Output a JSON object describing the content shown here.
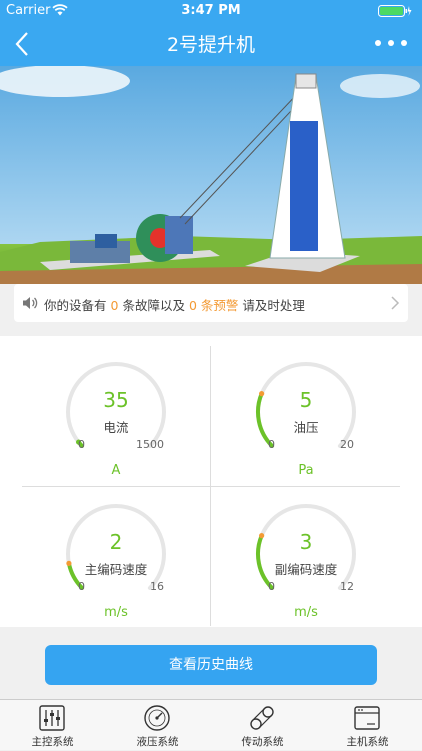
{
  "status_bar": {
    "carrier": "Carrier",
    "time": "3:47 PM"
  },
  "nav": {
    "title": "2号提升机"
  },
  "notice": {
    "prefix": "你的设备有",
    "fault_count": "0",
    "middle": "条故障以及",
    "warning_count": "0",
    "warning_word": "条预警",
    "suffix": "请及时处理"
  },
  "gauges": [
    {
      "value": "35",
      "label": "电流",
      "min": "0",
      "max": "1500",
      "unit": "A",
      "fraction": 0.023
    },
    {
      "value": "5",
      "label": "油压",
      "min": "0",
      "max": "20",
      "unit": "Pa",
      "fraction": 0.25
    },
    {
      "value": "2",
      "label": "主编码速度",
      "min": "0",
      "max": "16",
      "unit": "m/s",
      "fraction": 0.125
    },
    {
      "value": "3",
      "label": "副编码速度",
      "min": "0",
      "max": "12",
      "unit": "m/s",
      "fraction": 0.25
    }
  ],
  "history_button": "查看历史曲线",
  "tabs": [
    {
      "label": "主控系统",
      "icon": "sliders-icon"
    },
    {
      "label": "液压系统",
      "icon": "pressure-gauge-icon"
    },
    {
      "label": "传动系统",
      "icon": "transmission-icon"
    },
    {
      "label": "主机系统",
      "icon": "host-window-icon"
    }
  ],
  "colors": {
    "accent": "#3aa8f1",
    "green": "#6cc229",
    "orange": "#f39a34"
  }
}
